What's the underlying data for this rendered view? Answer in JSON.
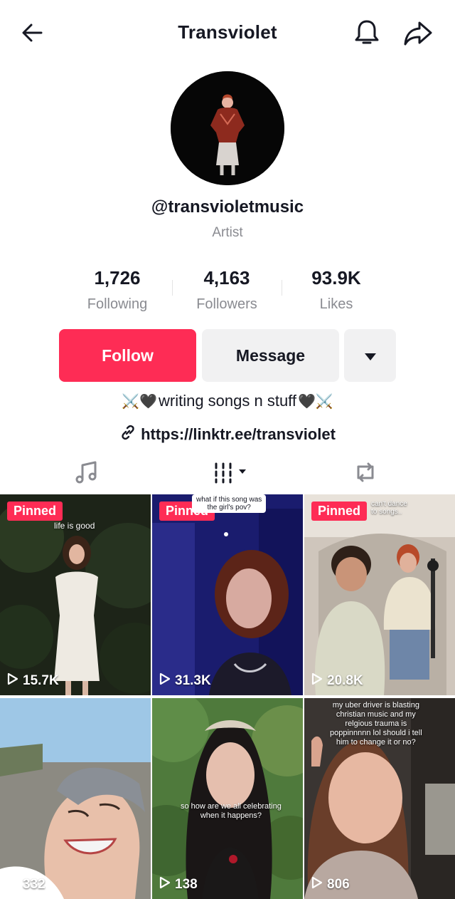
{
  "header": {
    "title": "Transviolet",
    "icons": [
      "back-arrow-icon",
      "bell-icon",
      "share-icon"
    ]
  },
  "profile": {
    "handle": "@transvioletmusic",
    "role": "Artist",
    "stats": [
      {
        "value": "1,726",
        "label": "Following"
      },
      {
        "value": "4,163",
        "label": "Followers"
      },
      {
        "value": "93.9K",
        "label": "Likes"
      }
    ],
    "actions": {
      "follow_label": "Follow",
      "message_label": "Message",
      "more_icon": "caret-down-icon"
    },
    "bio": {
      "emoji_left": "⚔️🖤",
      "text": "writing songs n stuff",
      "emoji_right": "🖤⚔️"
    },
    "link": "https://linktr.ee/transviolet"
  },
  "tabs": [
    {
      "icon": "music-note-icon"
    },
    {
      "icon": "videos-grid-icon"
    },
    {
      "icon": "repost-icon"
    }
  ],
  "videos": [
    {
      "pinned_label": "Pinned",
      "caption": "life is good",
      "views": "15.7K"
    },
    {
      "pinned_label": "Pinned",
      "caption": "what if this song was\nthe girl's pov?",
      "views": "31.3K"
    },
    {
      "pinned_label": "Pinned",
      "caption": "can't dance\nto songs..",
      "views": "20.8K"
    },
    {
      "pinned_label": "",
      "caption": "",
      "views": "332"
    },
    {
      "pinned_label": "",
      "caption": "so how are we all celebrating\nwhen it happens?",
      "views": "138"
    },
    {
      "pinned_label": "",
      "caption": "my uber driver is blasting\nchristian music and my\nrelgious trauma is\npoppinnnnn lol should i tell\nhim to change it or no?",
      "views": "806"
    }
  ],
  "colors": {
    "accent": "#fe2c55",
    "text_primary": "#161823",
    "text_secondary": "#8a8b91",
    "button_gray": "#f1f1f2"
  }
}
